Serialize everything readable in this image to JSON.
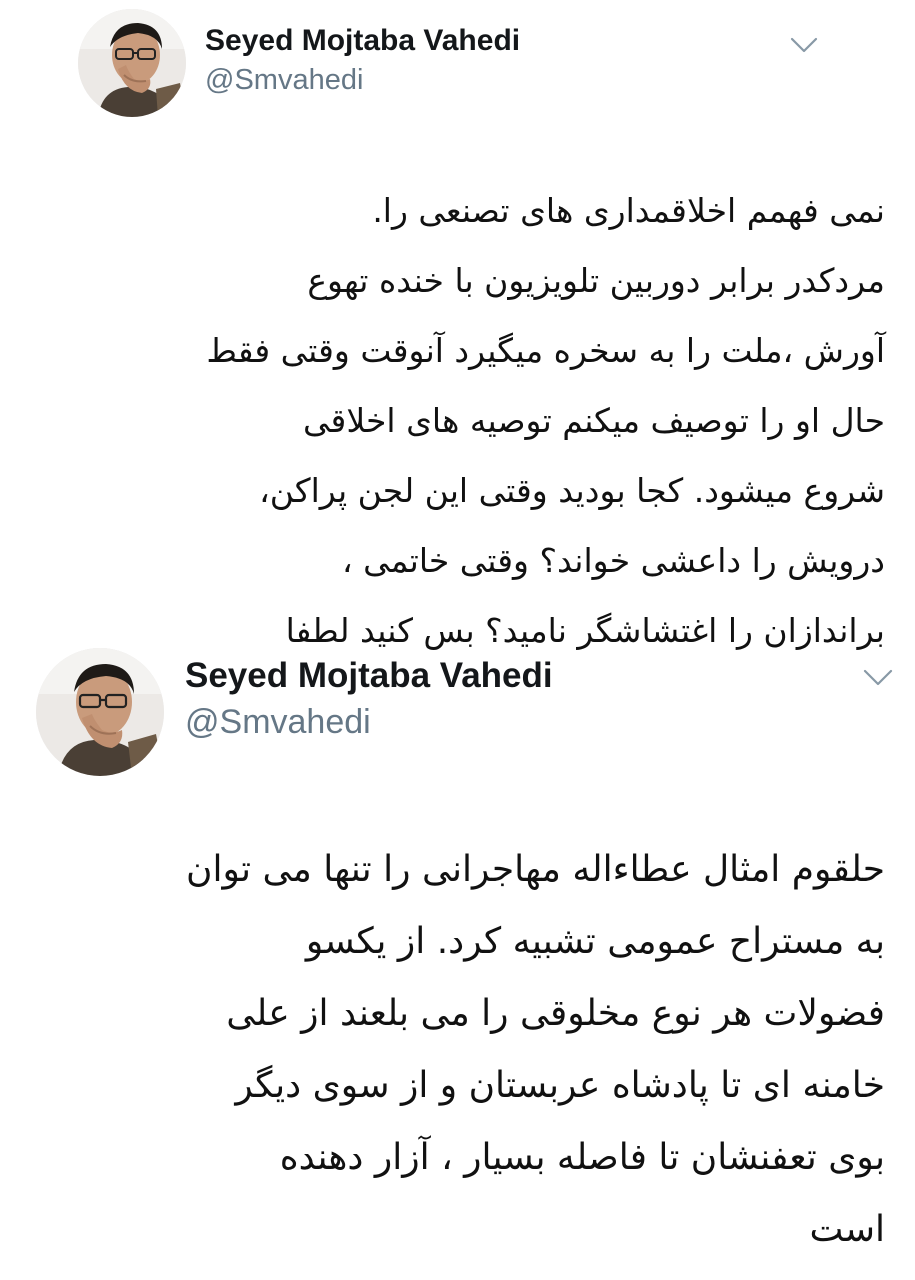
{
  "tweets": [
    {
      "author_name": "Seyed Mojtaba Vahedi",
      "handle": "@Smvahedi",
      "menu_icon": "chevron-down-icon",
      "lines": [
        "نمی فهمم اخلاقمداری های  تصنعی را.",
        "مردکدر برابر دوربین تلویزیون با خنده تهوع",
        "آورش ،ملت را به سخره میگیرد آنوقت وقتی فقط",
        "حال او را توصیف میکنم توصیه های اخلاقی",
        "شروع میشود. کجا بودید وقتی این لجن پراکن،",
        "درویش را داعشی خواند؟ وقتی خاتمی ،",
        "براندازان را اغتشاشگر نامید؟ بس کنید لطفا"
      ]
    },
    {
      "author_name": "Seyed Mojtaba Vahedi",
      "handle": "@Smvahedi",
      "menu_icon": "chevron-down-icon",
      "lines": [
        "حلقوم امثال عطاءاله مهاجرانی را تنها می توان",
        "به مستراح عمومی تشبیه کرد. از یکسو",
        "فضولات هر نوع  مخلوقی را می بلعند  از علی",
        "خامنه ای تا پادشاه عربستان و از سوی دیگر",
        "بوی تعفنشان  تا فاصله بسیار ، آزار دهنده",
        "است"
      ]
    }
  ],
  "colors": {
    "name": "#14171a",
    "handle": "#657786",
    "chevron": "#8899a6",
    "body": "#111111"
  }
}
